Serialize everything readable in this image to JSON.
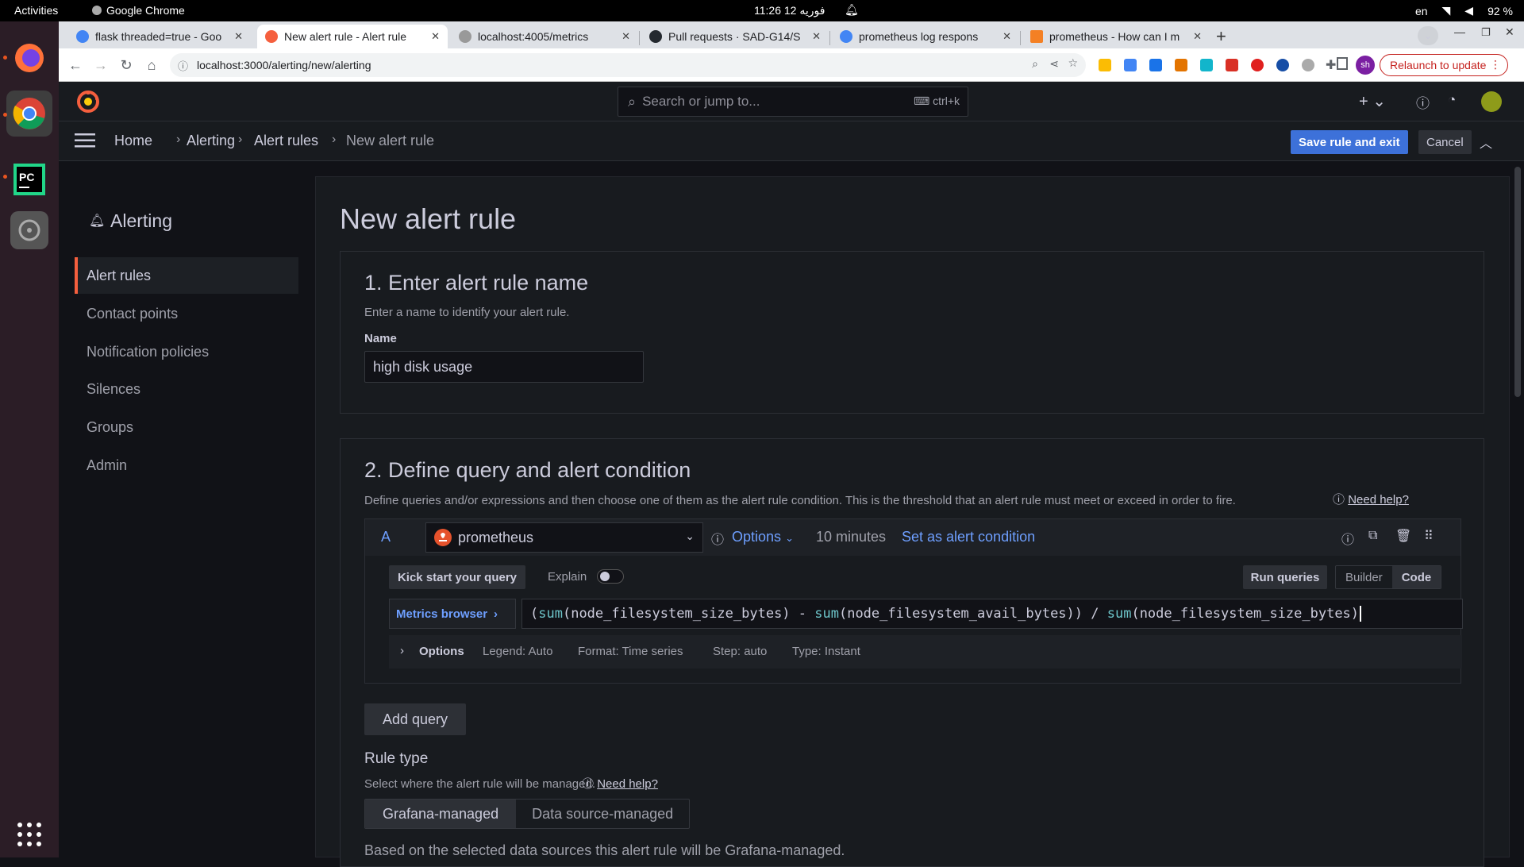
{
  "os": {
    "activities": "Activities",
    "app_name": "Google Chrome",
    "clock": "11:26  12 فوريه",
    "lang": "en",
    "battery": "92 %"
  },
  "browser": {
    "tabs": [
      {
        "label": "flask threaded=true - Goo",
        "active": false
      },
      {
        "label": "New alert rule - Alert rule",
        "active": true
      },
      {
        "label": "localhost:4005/metrics",
        "active": false
      },
      {
        "label": "Pull requests · SAD-G14/S",
        "active": false
      },
      {
        "label": "prometheus log respons",
        "active": false
      },
      {
        "label": "prometheus - How can I m",
        "active": false
      }
    ],
    "url": "localhost:3000/alerting/new/alerting",
    "relaunch": "Relaunch to update",
    "profile_initials": "sh"
  },
  "grafana": {
    "search_placeholder": "Search or jump to...",
    "search_shortcut": "ctrl+k",
    "breadcrumb": [
      "Home",
      "Alerting",
      "Alert rules",
      "New alert rule"
    ],
    "save_button": "Save rule and exit",
    "cancel_button": "Cancel"
  },
  "sidebar": {
    "title": "Alerting",
    "items": [
      {
        "label": "Alert rules",
        "active": true
      },
      {
        "label": "Contact points",
        "active": false
      },
      {
        "label": "Notification policies",
        "active": false
      },
      {
        "label": "Silences",
        "active": false
      },
      {
        "label": "Groups",
        "active": false
      },
      {
        "label": "Admin",
        "active": false
      }
    ]
  },
  "page": {
    "title": "New alert rule",
    "section1": {
      "title": "1. Enter alert rule name",
      "desc": "Enter a name to identify your alert rule.",
      "name_label": "Name",
      "name_value": "high disk usage"
    },
    "section2": {
      "title": "2. Define query and alert condition",
      "desc": "Define queries and/or expressions and then choose one of them as the alert rule condition. This is the threshold that an alert rule must meet or exceed in order to fire.",
      "help": "Need help?",
      "query": {
        "ref": "A",
        "datasource": "prometheus",
        "options_label": "Options",
        "time_range": "10 minutes",
        "set_condition": "Set as alert condition",
        "kickstart": "Kick start your query",
        "explain": "Explain",
        "run": "Run queries",
        "mode_builder": "Builder",
        "mode_code": "Code",
        "metrics_browser": "Metrics browser",
        "expr_parts": [
          {
            "text": "(",
            "fn": false
          },
          {
            "text": "sum",
            "fn": true
          },
          {
            "text": "(node_filesystem_size_bytes) - ",
            "fn": false
          },
          {
            "text": "sum",
            "fn": true
          },
          {
            "text": "(node_filesystem_avail_bytes)) / ",
            "fn": false
          },
          {
            "text": "sum",
            "fn": true
          },
          {
            "text": "(node_filesystem_size_bytes)",
            "fn": false
          }
        ],
        "opts_title": "Options",
        "legend": "Legend: Auto",
        "format": "Format: Time series",
        "step": "Step: auto",
        "type": "Type: Instant"
      },
      "add_query": "Add query",
      "rule_type_title": "Rule type",
      "rule_type_desc": "Select where the alert rule will be managed.",
      "rule_type_help": "Need help?",
      "rule_type_grafana": "Grafana-managed",
      "rule_type_ds": "Data source-managed",
      "rule_type_note": "Based on the selected data sources this alert rule will be Grafana-managed."
    }
  },
  "colors": {
    "accent": "#3d71d9",
    "grafana_orange": "#f55f3e",
    "ubuntu_orange": "#e95420"
  }
}
